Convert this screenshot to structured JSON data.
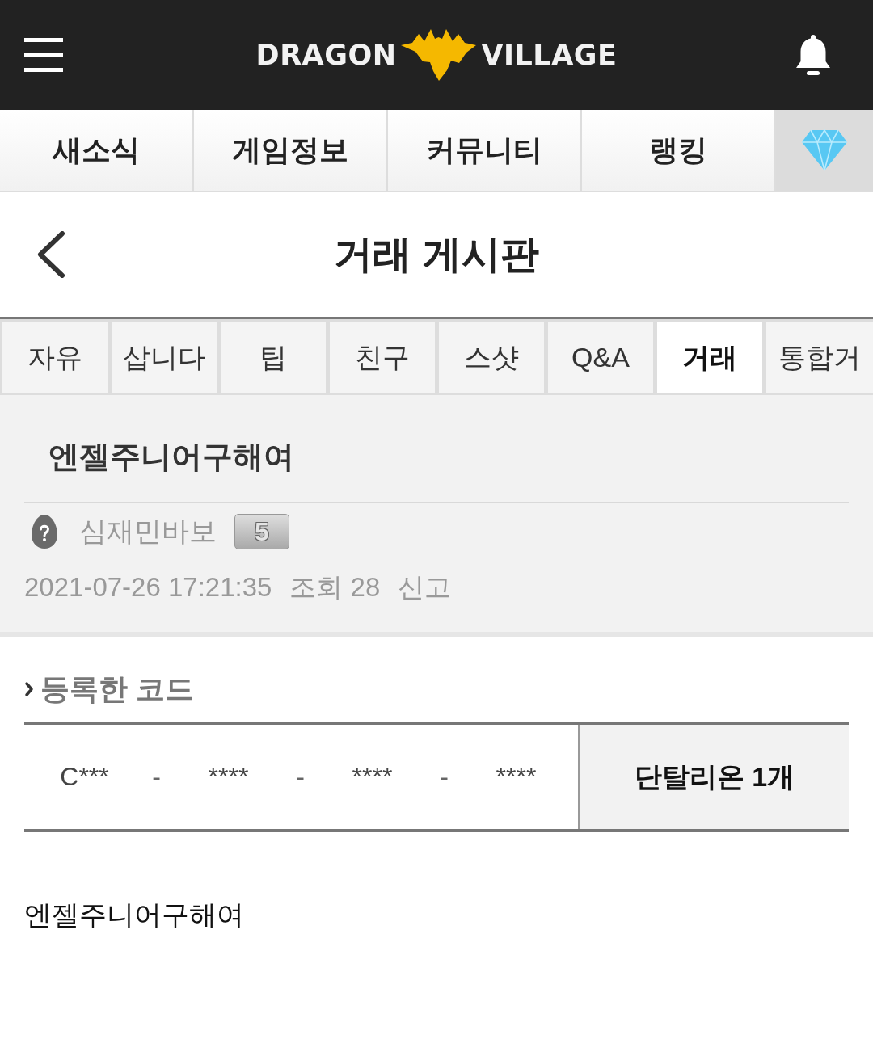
{
  "header": {
    "logo": {
      "left": "DRAGON",
      "right": "VILLAGE"
    }
  },
  "main_nav": [
    {
      "label": "새소식"
    },
    {
      "label": "게임정보"
    },
    {
      "label": "커뮤니티"
    },
    {
      "label": "랭킹"
    }
  ],
  "page": {
    "title": "거래 게시판"
  },
  "board_tabs": [
    {
      "label": "자유",
      "selected": false
    },
    {
      "label": "삽니다",
      "selected": false
    },
    {
      "label": "팁",
      "selected": false
    },
    {
      "label": "친구",
      "selected": false
    },
    {
      "label": "스샷",
      "selected": false
    },
    {
      "label": "Q&A",
      "selected": false
    },
    {
      "label": "거래",
      "selected": true
    },
    {
      "label": "통합거",
      "selected": false
    }
  ],
  "post": {
    "title": "엔젤주니어구해여",
    "author": "심재민바보",
    "level_badge": "5",
    "datetime": "2021-07-26 17:21:35",
    "views": "조회 28",
    "report": "신고"
  },
  "code_section": {
    "heading": "등록한 코드",
    "code": [
      {
        "kind": "segment",
        "text": "C***"
      },
      {
        "kind": "separator",
        "text": "-"
      },
      {
        "kind": "segment",
        "text": "****"
      },
      {
        "kind": "separator",
        "text": "-"
      },
      {
        "kind": "segment",
        "text": "****"
      },
      {
        "kind": "separator",
        "text": "-"
      },
      {
        "kind": "segment",
        "text": "****"
      }
    ],
    "reward": "단탈리온 1개"
  },
  "body": "엔젤주니어구해여"
}
